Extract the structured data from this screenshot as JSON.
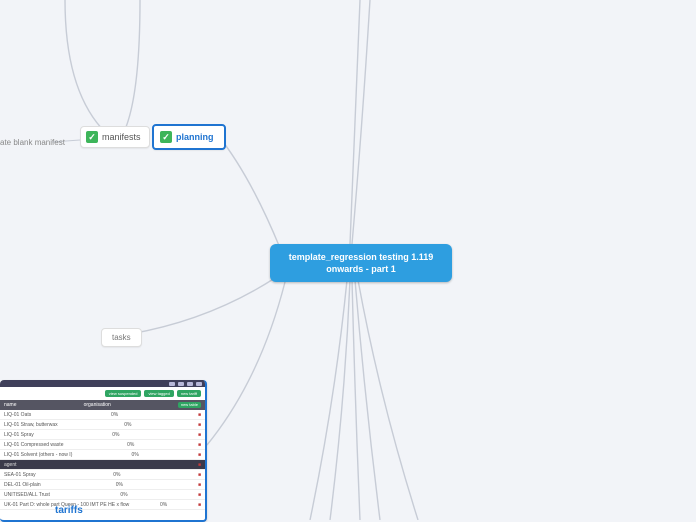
{
  "central": {
    "title": "template_regression testing 1.119 onwards - part 1"
  },
  "nodes": {
    "planning": "planning",
    "manifests": "manifests",
    "tasks": "tasks",
    "blank_manifest": "ate blank manifest"
  },
  "tariffs": {
    "label": "tariffs",
    "chips": [
      "view suspended",
      "view tagged",
      "new tariff"
    ],
    "columns": {
      "left": "name",
      "right": "organisation"
    },
    "right_chip": "new table",
    "rows": [
      {
        "l": "LIQ-01 Oats",
        "r": "0%"
      },
      {
        "l": "LIQ-01 Straw, butterwax",
        "r": "0%"
      },
      {
        "l": "LIQ-01 Spray",
        "r": "0%"
      },
      {
        "l": "LIQ-01 Compressed waste",
        "r": "0%"
      },
      {
        "l": "LIQ-01 Solvent (others - now I)",
        "r": "0%"
      },
      {
        "l": "agent",
        "r": ""
      },
      {
        "l": "SEA-01 Spray",
        "r": "0%"
      },
      {
        "l": "DEL-01 Oil-plain",
        "r": "0%"
      },
      {
        "l": "UNITISED/ALL Trust",
        "r": "0%"
      },
      {
        "l": "UK-01 Part D: whole part Queen - 100 IMT PE HE x flow",
        "r": "0%"
      }
    ]
  }
}
